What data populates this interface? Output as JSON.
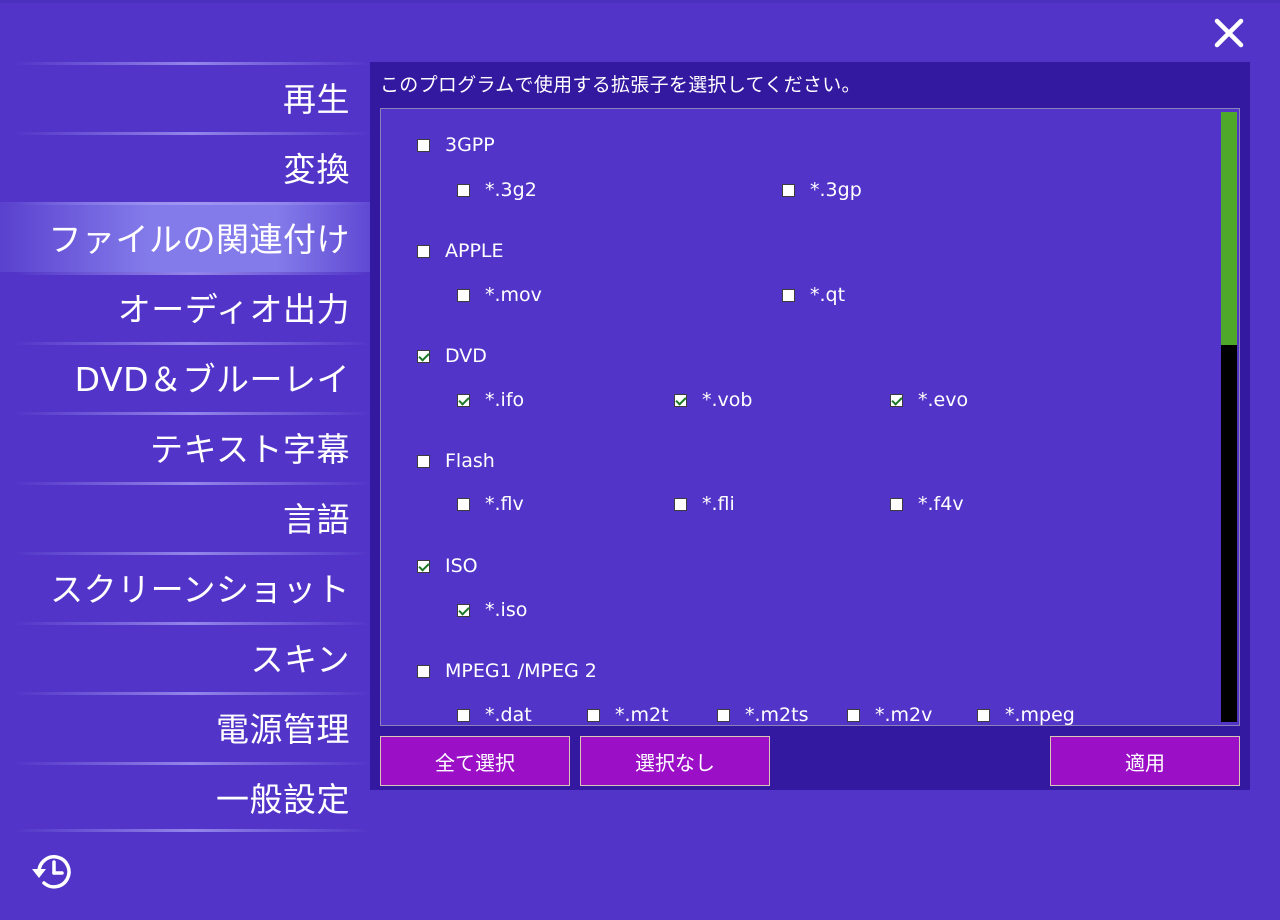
{
  "sidebar": {
    "items": [
      {
        "label": "再生"
      },
      {
        "label": "変換"
      },
      {
        "label": "ファイルの関連付け"
      },
      {
        "label": "オーディオ出力"
      },
      {
        "label": "DVD＆ブルーレイ"
      },
      {
        "label": "テキスト字幕"
      },
      {
        "label": "言語"
      },
      {
        "label": "スクリーンショット"
      },
      {
        "label": "スキン"
      },
      {
        "label": "電源管理"
      },
      {
        "label": "一般設定"
      }
    ],
    "active_index": 2
  },
  "panel": {
    "title": "このプログラムで使用する拡張子を選択してください。",
    "groups": [
      {
        "label": "3GPP",
        "checked": false,
        "extensions": [
          {
            "label": "*.3g2",
            "checked": false
          },
          {
            "label": "*.3gp",
            "checked": false
          }
        ]
      },
      {
        "label": "APPLE",
        "checked": false,
        "extensions": [
          {
            "label": "*.mov",
            "checked": false
          },
          {
            "label": "*.qt",
            "checked": false
          }
        ]
      },
      {
        "label": "DVD",
        "checked": true,
        "extensions": [
          {
            "label": "*.ifo",
            "checked": true
          },
          {
            "label": "*.vob",
            "checked": true
          },
          {
            "label": "*.evo",
            "checked": true
          }
        ]
      },
      {
        "label": "Flash",
        "checked": false,
        "extensions": [
          {
            "label": "*.flv",
            "checked": false
          },
          {
            "label": "*.fli",
            "checked": false
          },
          {
            "label": "*.f4v",
            "checked": false
          }
        ]
      },
      {
        "label": "ISO",
        "checked": true,
        "extensions": [
          {
            "label": "*.iso",
            "checked": true
          }
        ]
      },
      {
        "label": "MPEG1 /MPEG 2",
        "checked": false,
        "extensions": [
          {
            "label": "*.dat",
            "checked": false
          },
          {
            "label": "*.m2t",
            "checked": false
          },
          {
            "label": "*.m2ts",
            "checked": false
          },
          {
            "label": "*.m2v",
            "checked": false
          },
          {
            "label": "*.mpeg",
            "checked": false
          }
        ]
      }
    ],
    "scroll_fraction": 0.38
  },
  "buttons": {
    "select_all": "全て選択",
    "select_none": "選択なし",
    "apply": "適用"
  },
  "colors": {
    "background": "#5235c8",
    "panel": "#3318a0",
    "button": "#9b10c6",
    "scroll_thumb": "#4fa82a"
  },
  "icons": {
    "close": "close-icon",
    "history": "history-icon"
  }
}
